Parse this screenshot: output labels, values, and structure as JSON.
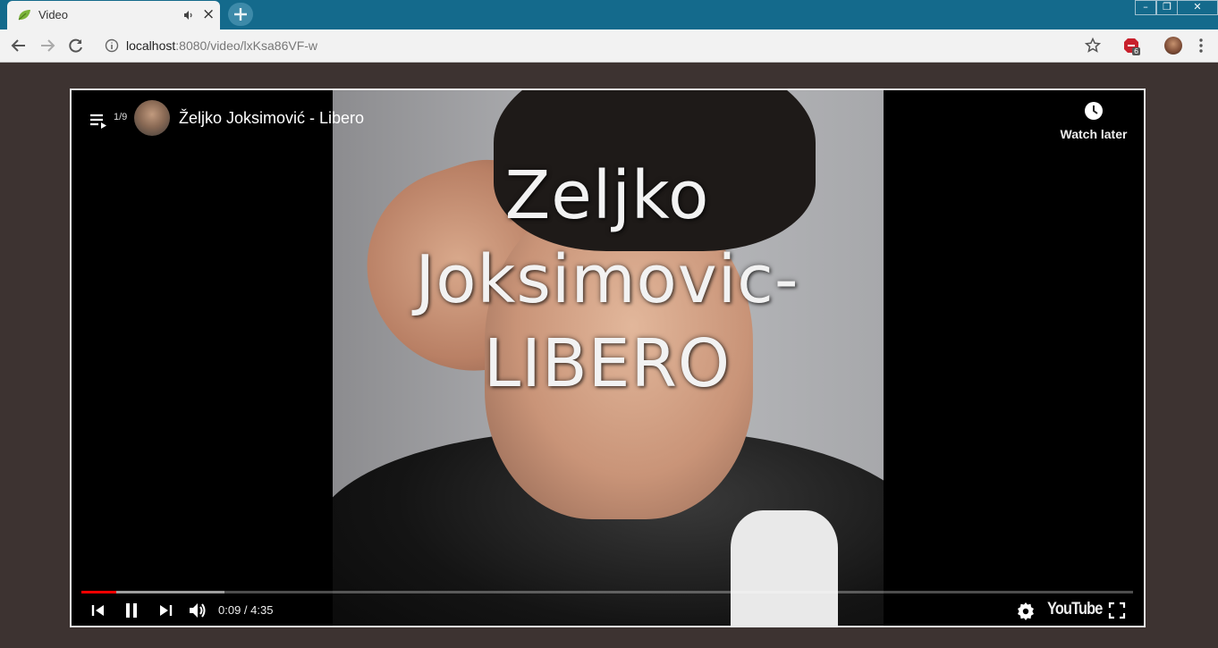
{
  "browser": {
    "tab": {
      "title": "Video",
      "favicon": "leaf-icon",
      "audio_icon": "speaker-icon",
      "close_label": "×"
    },
    "new_tab_icon": "plus-icon",
    "window_controls": {
      "minimize": "–",
      "restore": "❐",
      "close": "✕"
    },
    "toolbar": {
      "back_icon": "arrow-left-icon",
      "forward_icon": "arrow-right-icon",
      "reload_icon": "reload-icon",
      "info_icon": "info-icon",
      "url_host": "localhost",
      "url_path": ":8080/video/lxKsa86VF-w",
      "bookmark_icon": "star-icon",
      "extension_badge": "6",
      "menu_icon": "kebab-icon"
    }
  },
  "player": {
    "playlist_position": "1/9",
    "video_title": "Željko Joksimović - Libero",
    "watch_later_label": "Watch later",
    "caption_lines": [
      "Zeljko",
      "Joksimovic-",
      "LIBERO"
    ],
    "current_time": "0:09",
    "duration": "4:35",
    "time_display": "0:09 / 4:35",
    "progress_played_fraction": 0.033,
    "progress_buffered_fraction": 0.136,
    "logo_text": "YouTube",
    "accent_color": "#ff0000"
  },
  "colors": {
    "titlebar": "#146a8c",
    "page_background": "#3d3331",
    "toolbar": "#f2f2f2"
  }
}
